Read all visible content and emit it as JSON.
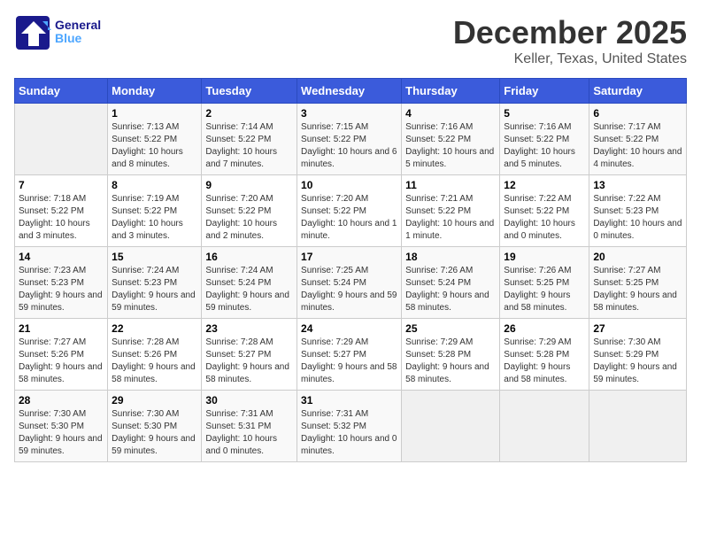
{
  "logo": {
    "text_general": "General",
    "text_blue": "Blue"
  },
  "title": "December 2025",
  "subtitle": "Keller, Texas, United States",
  "header": {
    "accent_color": "#3b5bdb"
  },
  "days_of_week": [
    "Sunday",
    "Monday",
    "Tuesday",
    "Wednesday",
    "Thursday",
    "Friday",
    "Saturday"
  ],
  "weeks": [
    [
      {
        "day": "",
        "sunrise": "",
        "sunset": "",
        "daylight": "",
        "empty": true
      },
      {
        "day": "1",
        "sunrise": "Sunrise: 7:13 AM",
        "sunset": "Sunset: 5:22 PM",
        "daylight": "Daylight: 10 hours and 8 minutes."
      },
      {
        "day": "2",
        "sunrise": "Sunrise: 7:14 AM",
        "sunset": "Sunset: 5:22 PM",
        "daylight": "Daylight: 10 hours and 7 minutes."
      },
      {
        "day": "3",
        "sunrise": "Sunrise: 7:15 AM",
        "sunset": "Sunset: 5:22 PM",
        "daylight": "Daylight: 10 hours and 6 minutes."
      },
      {
        "day": "4",
        "sunrise": "Sunrise: 7:16 AM",
        "sunset": "Sunset: 5:22 PM",
        "daylight": "Daylight: 10 hours and 5 minutes."
      },
      {
        "day": "5",
        "sunrise": "Sunrise: 7:16 AM",
        "sunset": "Sunset: 5:22 PM",
        "daylight": "Daylight: 10 hours and 5 minutes."
      },
      {
        "day": "6",
        "sunrise": "Sunrise: 7:17 AM",
        "sunset": "Sunset: 5:22 PM",
        "daylight": "Daylight: 10 hours and 4 minutes."
      }
    ],
    [
      {
        "day": "7",
        "sunrise": "Sunrise: 7:18 AM",
        "sunset": "Sunset: 5:22 PM",
        "daylight": "Daylight: 10 hours and 3 minutes."
      },
      {
        "day": "8",
        "sunrise": "Sunrise: 7:19 AM",
        "sunset": "Sunset: 5:22 PM",
        "daylight": "Daylight: 10 hours and 3 minutes."
      },
      {
        "day": "9",
        "sunrise": "Sunrise: 7:20 AM",
        "sunset": "Sunset: 5:22 PM",
        "daylight": "Daylight: 10 hours and 2 minutes."
      },
      {
        "day": "10",
        "sunrise": "Sunrise: 7:20 AM",
        "sunset": "Sunset: 5:22 PM",
        "daylight": "Daylight: 10 hours and 1 minute."
      },
      {
        "day": "11",
        "sunrise": "Sunrise: 7:21 AM",
        "sunset": "Sunset: 5:22 PM",
        "daylight": "Daylight: 10 hours and 1 minute."
      },
      {
        "day": "12",
        "sunrise": "Sunrise: 7:22 AM",
        "sunset": "Sunset: 5:22 PM",
        "daylight": "Daylight: 10 hours and 0 minutes."
      },
      {
        "day": "13",
        "sunrise": "Sunrise: 7:22 AM",
        "sunset": "Sunset: 5:23 PM",
        "daylight": "Daylight: 10 hours and 0 minutes."
      }
    ],
    [
      {
        "day": "14",
        "sunrise": "Sunrise: 7:23 AM",
        "sunset": "Sunset: 5:23 PM",
        "daylight": "Daylight: 9 hours and 59 minutes."
      },
      {
        "day": "15",
        "sunrise": "Sunrise: 7:24 AM",
        "sunset": "Sunset: 5:23 PM",
        "daylight": "Daylight: 9 hours and 59 minutes."
      },
      {
        "day": "16",
        "sunrise": "Sunrise: 7:24 AM",
        "sunset": "Sunset: 5:24 PM",
        "daylight": "Daylight: 9 hours and 59 minutes."
      },
      {
        "day": "17",
        "sunrise": "Sunrise: 7:25 AM",
        "sunset": "Sunset: 5:24 PM",
        "daylight": "Daylight: 9 hours and 59 minutes."
      },
      {
        "day": "18",
        "sunrise": "Sunrise: 7:26 AM",
        "sunset": "Sunset: 5:24 PM",
        "daylight": "Daylight: 9 hours and 58 minutes."
      },
      {
        "day": "19",
        "sunrise": "Sunrise: 7:26 AM",
        "sunset": "Sunset: 5:25 PM",
        "daylight": "Daylight: 9 hours and 58 minutes."
      },
      {
        "day": "20",
        "sunrise": "Sunrise: 7:27 AM",
        "sunset": "Sunset: 5:25 PM",
        "daylight": "Daylight: 9 hours and 58 minutes."
      }
    ],
    [
      {
        "day": "21",
        "sunrise": "Sunrise: 7:27 AM",
        "sunset": "Sunset: 5:26 PM",
        "daylight": "Daylight: 9 hours and 58 minutes."
      },
      {
        "day": "22",
        "sunrise": "Sunrise: 7:28 AM",
        "sunset": "Sunset: 5:26 PM",
        "daylight": "Daylight: 9 hours and 58 minutes."
      },
      {
        "day": "23",
        "sunrise": "Sunrise: 7:28 AM",
        "sunset": "Sunset: 5:27 PM",
        "daylight": "Daylight: 9 hours and 58 minutes."
      },
      {
        "day": "24",
        "sunrise": "Sunrise: 7:29 AM",
        "sunset": "Sunset: 5:27 PM",
        "daylight": "Daylight: 9 hours and 58 minutes."
      },
      {
        "day": "25",
        "sunrise": "Sunrise: 7:29 AM",
        "sunset": "Sunset: 5:28 PM",
        "daylight": "Daylight: 9 hours and 58 minutes."
      },
      {
        "day": "26",
        "sunrise": "Sunrise: 7:29 AM",
        "sunset": "Sunset: 5:28 PM",
        "daylight": "Daylight: 9 hours and 58 minutes."
      },
      {
        "day": "27",
        "sunrise": "Sunrise: 7:30 AM",
        "sunset": "Sunset: 5:29 PM",
        "daylight": "Daylight: 9 hours and 59 minutes."
      }
    ],
    [
      {
        "day": "28",
        "sunrise": "Sunrise: 7:30 AM",
        "sunset": "Sunset: 5:30 PM",
        "daylight": "Daylight: 9 hours and 59 minutes."
      },
      {
        "day": "29",
        "sunrise": "Sunrise: 7:30 AM",
        "sunset": "Sunset: 5:30 PM",
        "daylight": "Daylight: 9 hours and 59 minutes."
      },
      {
        "day": "30",
        "sunrise": "Sunrise: 7:31 AM",
        "sunset": "Sunset: 5:31 PM",
        "daylight": "Daylight: 10 hours and 0 minutes."
      },
      {
        "day": "31",
        "sunrise": "Sunrise: 7:31 AM",
        "sunset": "Sunset: 5:32 PM",
        "daylight": "Daylight: 10 hours and 0 minutes."
      },
      {
        "day": "",
        "sunrise": "",
        "sunset": "",
        "daylight": "",
        "empty": true
      },
      {
        "day": "",
        "sunrise": "",
        "sunset": "",
        "daylight": "",
        "empty": true
      },
      {
        "day": "",
        "sunrise": "",
        "sunset": "",
        "daylight": "",
        "empty": true
      }
    ]
  ]
}
